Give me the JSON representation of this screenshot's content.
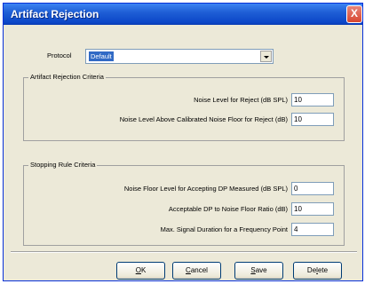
{
  "window": {
    "title": "Artifact Rejection",
    "close_label": "X"
  },
  "protocol": {
    "label": "Protocol",
    "value": "Default"
  },
  "artifact_group": {
    "title": "Artifact Rejection Criteria",
    "fields": [
      {
        "label": "Noise Level for Reject (dB SPL)",
        "value": "10"
      },
      {
        "label": "Noise Level Above Calibrated Noise Floor for Reject (dB)",
        "value": "10"
      }
    ]
  },
  "stopping_group": {
    "title": "Stopping Rule Criteria",
    "fields": [
      {
        "label": "Noise Floor Level for Accepting DP Measured (dB SPL)",
        "value": "0"
      },
      {
        "label": "Acceptable DP to Noise Floor Ratio (dB)",
        "value": "10"
      },
      {
        "label": "Max. Signal Duration for a Frequency Point",
        "value": "4"
      }
    ]
  },
  "buttons": {
    "ok": {
      "accel": "O",
      "rest": "K"
    },
    "cancel": {
      "accel": "C",
      "rest": "ancel"
    },
    "save": {
      "accel": "S",
      "rest": "ave"
    },
    "delete": {
      "pre": "De",
      "accel": "l",
      "rest": "ete"
    }
  }
}
